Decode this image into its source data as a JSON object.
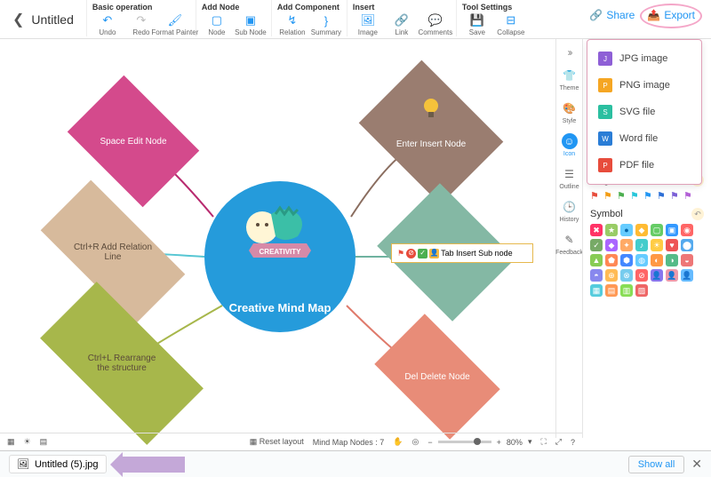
{
  "doc": {
    "title": "Untitled"
  },
  "toolbar": {
    "groups": {
      "basic": {
        "label": "Basic operation",
        "undo": "Undo",
        "redo": "Redo",
        "format": "Format Painter"
      },
      "addnode": {
        "label": "Add Node",
        "node": "Node",
        "sub": "Sub Node"
      },
      "addcomp": {
        "label": "Add Component",
        "relation": "Relation",
        "summary": "Summary"
      },
      "insert": {
        "label": "Insert",
        "image": "Image",
        "link": "Link",
        "comments": "Comments"
      },
      "tools": {
        "label": "Tool Settings",
        "save": "Save",
        "collapse": "Collapse"
      }
    },
    "share": "Share",
    "export": "Export"
  },
  "export_menu": {
    "jpg": "JPG image",
    "png": "PNG image",
    "svg": "SVG file",
    "word": "Word file",
    "pdf": "PDF file"
  },
  "nodes": {
    "center": "Creative Mind Map",
    "center_banner": "CREATIVITY",
    "n1": "Space Edit Node",
    "n2": "Ctrl+R Add Relation Line",
    "n3": "Ctrl+L Rearrange the structure",
    "n4": "Enter Insert Node",
    "n5": "Del Delete Node",
    "sub1": "Tab Insert Sub node"
  },
  "dock": {
    "expand": ">>",
    "theme": "Theme",
    "style": "Style",
    "icon": "Icon",
    "outline": "Outline",
    "history": "History",
    "feedback": "Feedback"
  },
  "panel": {
    "flag": "Flag",
    "symbol": "Symbol"
  },
  "bottombar": {
    "reset": "Reset layout",
    "nodes_label": "Mind Map Nodes :",
    "nodes_count": "7",
    "zoom": "80%"
  },
  "download": {
    "filename": "Untitled (5).jpg",
    "showall": "Show all"
  }
}
